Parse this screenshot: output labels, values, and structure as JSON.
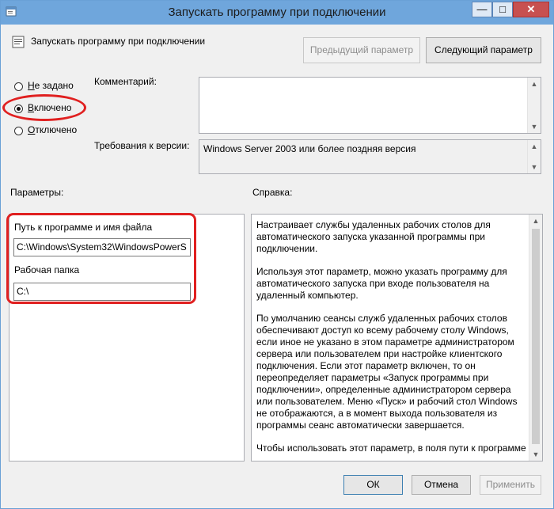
{
  "window": {
    "title": "Запускать программу при подключении",
    "buttons": {
      "minimize": "—",
      "maximize": "□",
      "close": "✕"
    }
  },
  "header": {
    "policy_name": "Запускать программу при подключении",
    "prev_button": "Предыдущий параметр",
    "next_button": "Следующий параметр"
  },
  "state": {
    "options": [
      {
        "label": "Не задано",
        "accel": "Н",
        "rest": "е задано",
        "selected": false
      },
      {
        "label": "Включено",
        "accel": "В",
        "rest": "ключено",
        "selected": true
      },
      {
        "label": "Отключено",
        "accel": "О",
        "rest": "тключено",
        "selected": false
      }
    ]
  },
  "comment": {
    "label": "Комментарий:",
    "value": ""
  },
  "requirements": {
    "label": "Требования к версии:",
    "value": "Windows Server 2003 или более поздняя версия"
  },
  "options_section": {
    "title": "Параметры:",
    "program_label": "Путь к программе и имя файла",
    "program_value": "C:\\Windows\\System32\\WindowsPowerS",
    "folder_label": "Рабочая папка",
    "folder_value": "C:\\"
  },
  "help": {
    "title": "Справка:",
    "paragraphs": [
      "Настраивает службы удаленных рабочих столов для автоматического запуска указанной программы при подключении.",
      "Используя этот параметр, можно указать программу для автоматического запуска при входе пользователя на удаленный компьютер.",
      "По умолчанию сеансы служб удаленных рабочих столов обеспечивают доступ ко всему рабочему столу Windows, если иное не указано в этом параметре администратором сервера или пользователем при настройке клиентского подключения. Если этот параметр включен, то он переопределяет параметры «Запуск программы при подключении», определенные администратором сервера или пользователем. Меню «Пуск» и рабочий стол Windows не отображаются, а в момент выхода пользователя из программы сеанс автоматически завершается.",
      "Чтобы использовать этот параметр, в поля пути к программе"
    ]
  },
  "footer": {
    "ok": "ОК",
    "cancel": "Отмена",
    "apply": "Применить"
  },
  "colors": {
    "annotation": "#e02020",
    "titlebar": "#6fa6dc"
  }
}
